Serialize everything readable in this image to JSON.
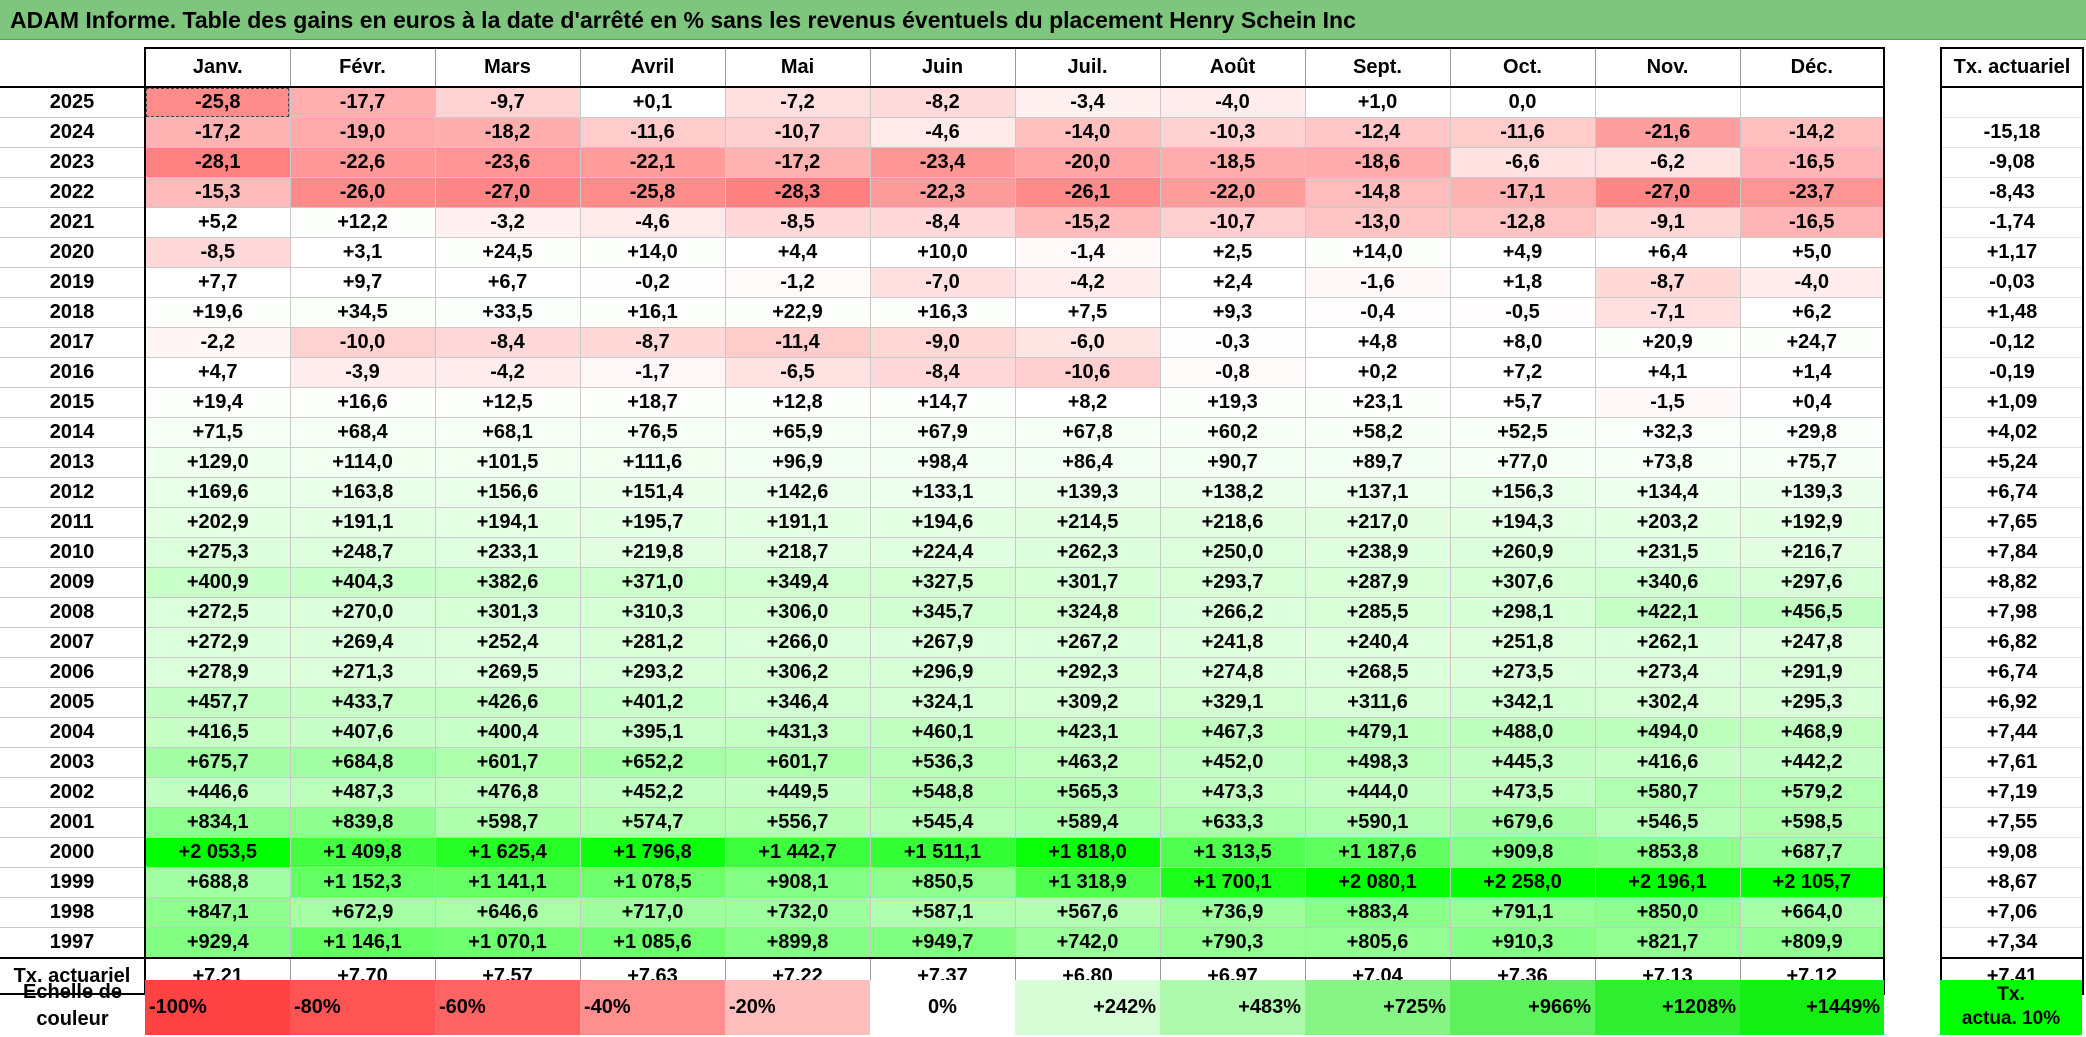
{
  "title": "ADAM Informe. Table des gains en euros à la date d'arrêté en % sans les revenus éventuels du placement Henry Schein Inc",
  "months": [
    "Janv.",
    "Févr.",
    "Mars",
    "Avril",
    "Mai",
    "Juin",
    "Juil.",
    "Août",
    "Sept.",
    "Oct.",
    "Nov.",
    "Déc."
  ],
  "rate_header": "Tx. actuariel",
  "rows": [
    {
      "year": "2025",
      "values": [
        "-25,8",
        "-17,7",
        "-9,7",
        "+0,1",
        "-7,2",
        "-8,2",
        "-3,4",
        "-4,0",
        "+1,0",
        "0,0",
        "",
        ""
      ],
      "rate": ""
    },
    {
      "year": "2024",
      "values": [
        "-17,2",
        "-19,0",
        "-18,2",
        "-11,6",
        "-10,7",
        "-4,6",
        "-14,0",
        "-10,3",
        "-12,4",
        "-11,6",
        "-21,6",
        "-14,2"
      ],
      "rate": "-15,18"
    },
    {
      "year": "2023",
      "values": [
        "-28,1",
        "-22,6",
        "-23,6",
        "-22,1",
        "-17,2",
        "-23,4",
        "-20,0",
        "-18,5",
        "-18,6",
        "-6,6",
        "-6,2",
        "-16,5"
      ],
      "rate": "-9,08"
    },
    {
      "year": "2022",
      "values": [
        "-15,3",
        "-26,0",
        "-27,0",
        "-25,8",
        "-28,3",
        "-22,3",
        "-26,1",
        "-22,0",
        "-14,8",
        "-17,1",
        "-27,0",
        "-23,7"
      ],
      "rate": "-8,43"
    },
    {
      "year": "2021",
      "values": [
        "+5,2",
        "+12,2",
        "-3,2",
        "-4,6",
        "-8,5",
        "-8,4",
        "-15,2",
        "-10,7",
        "-13,0",
        "-12,8",
        "-9,1",
        "-16,5"
      ],
      "rate": "-1,74"
    },
    {
      "year": "2020",
      "values": [
        "-8,5",
        "+3,1",
        "+24,5",
        "+14,0",
        "+4,4",
        "+10,0",
        "-1,4",
        "+2,5",
        "+14,0",
        "+4,9",
        "+6,4",
        "+5,0"
      ],
      "rate": "+1,17"
    },
    {
      "year": "2019",
      "values": [
        "+7,7",
        "+9,7",
        "+6,7",
        "-0,2",
        "-1,2",
        "-7,0",
        "-4,2",
        "+2,4",
        "-1,6",
        "+1,8",
        "-8,7",
        "-4,0"
      ],
      "rate": "-0,03"
    },
    {
      "year": "2018",
      "values": [
        "+19,6",
        "+34,5",
        "+33,5",
        "+16,1",
        "+22,9",
        "+16,3",
        "+7,5",
        "+9,3",
        "-0,4",
        "-0,5",
        "-7,1",
        "+6,2"
      ],
      "rate": "+1,48"
    },
    {
      "year": "2017",
      "values": [
        "-2,2",
        "-10,0",
        "-8,4",
        "-8,7",
        "-11,4",
        "-9,0",
        "-6,0",
        "-0,3",
        "+4,8",
        "+8,0",
        "+20,9",
        "+24,7"
      ],
      "rate": "-0,12"
    },
    {
      "year": "2016",
      "values": [
        "+4,7",
        "-3,9",
        "-4,2",
        "-1,7",
        "-6,5",
        "-8,4",
        "-10,6",
        "-0,8",
        "+0,2",
        "+7,2",
        "+4,1",
        "+1,4"
      ],
      "rate": "-0,19"
    },
    {
      "year": "2015",
      "values": [
        "+19,4",
        "+16,6",
        "+12,5",
        "+18,7",
        "+12,8",
        "+14,7",
        "+8,2",
        "+19,3",
        "+23,1",
        "+5,7",
        "-1,5",
        "+0,4"
      ],
      "rate": "+1,09"
    },
    {
      "year": "2014",
      "values": [
        "+71,5",
        "+68,4",
        "+68,1",
        "+76,5",
        "+65,9",
        "+67,9",
        "+67,8",
        "+60,2",
        "+58,2",
        "+52,5",
        "+32,3",
        "+29,8"
      ],
      "rate": "+4,02"
    },
    {
      "year": "2013",
      "values": [
        "+129,0",
        "+114,0",
        "+101,5",
        "+111,6",
        "+96,9",
        "+98,4",
        "+86,4",
        "+90,7",
        "+89,7",
        "+77,0",
        "+73,8",
        "+75,7"
      ],
      "rate": "+5,24"
    },
    {
      "year": "2012",
      "values": [
        "+169,6",
        "+163,8",
        "+156,6",
        "+151,4",
        "+142,6",
        "+133,1",
        "+139,3",
        "+138,2",
        "+137,1",
        "+156,3",
        "+134,4",
        "+139,3"
      ],
      "rate": "+6,74"
    },
    {
      "year": "2011",
      "values": [
        "+202,9",
        "+191,1",
        "+194,1",
        "+195,7",
        "+191,1",
        "+194,6",
        "+214,5",
        "+218,6",
        "+217,0",
        "+194,3",
        "+203,2",
        "+192,9"
      ],
      "rate": "+7,65"
    },
    {
      "year": "2010",
      "values": [
        "+275,3",
        "+248,7",
        "+233,1",
        "+219,8",
        "+218,7",
        "+224,4",
        "+262,3",
        "+250,0",
        "+238,9",
        "+260,9",
        "+231,5",
        "+216,7"
      ],
      "rate": "+7,84"
    },
    {
      "year": "2009",
      "values": [
        "+400,9",
        "+404,3",
        "+382,6",
        "+371,0",
        "+349,4",
        "+327,5",
        "+301,7",
        "+293,7",
        "+287,9",
        "+307,6",
        "+340,6",
        "+297,6"
      ],
      "rate": "+8,82"
    },
    {
      "year": "2008",
      "values": [
        "+272,5",
        "+270,0",
        "+301,3",
        "+310,3",
        "+306,0",
        "+345,7",
        "+324,8",
        "+266,2",
        "+285,5",
        "+298,1",
        "+422,1",
        "+456,5"
      ],
      "rate": "+7,98"
    },
    {
      "year": "2007",
      "values": [
        "+272,9",
        "+269,4",
        "+252,4",
        "+281,2",
        "+266,0",
        "+267,9",
        "+267,2",
        "+241,8",
        "+240,4",
        "+251,8",
        "+262,1",
        "+247,8"
      ],
      "rate": "+6,82"
    },
    {
      "year": "2006",
      "values": [
        "+278,9",
        "+271,3",
        "+269,5",
        "+293,2",
        "+306,2",
        "+296,9",
        "+292,3",
        "+274,8",
        "+268,5",
        "+273,5",
        "+273,4",
        "+291,9"
      ],
      "rate": "+6,74"
    },
    {
      "year": "2005",
      "values": [
        "+457,7",
        "+433,7",
        "+426,6",
        "+401,2",
        "+346,4",
        "+324,1",
        "+309,2",
        "+329,1",
        "+311,6",
        "+342,1",
        "+302,4",
        "+295,3"
      ],
      "rate": "+6,92"
    },
    {
      "year": "2004",
      "values": [
        "+416,5",
        "+407,6",
        "+400,4",
        "+395,1",
        "+431,3",
        "+460,1",
        "+423,1",
        "+467,3",
        "+479,1",
        "+488,0",
        "+494,0",
        "+468,9"
      ],
      "rate": "+7,44"
    },
    {
      "year": "2003",
      "values": [
        "+675,7",
        "+684,8",
        "+601,7",
        "+652,2",
        "+601,7",
        "+536,3",
        "+463,2",
        "+452,0",
        "+498,3",
        "+445,3",
        "+416,6",
        "+442,2"
      ],
      "rate": "+7,61"
    },
    {
      "year": "2002",
      "values": [
        "+446,6",
        "+487,3",
        "+476,8",
        "+452,2",
        "+449,5",
        "+548,8",
        "+565,3",
        "+473,3",
        "+444,0",
        "+473,5",
        "+580,7",
        "+579,2"
      ],
      "rate": "+7,19"
    },
    {
      "year": "2001",
      "values": [
        "+834,1",
        "+839,8",
        "+598,7",
        "+574,7",
        "+556,7",
        "+545,4",
        "+589,4",
        "+633,3",
        "+590,1",
        "+679,6",
        "+546,5",
        "+598,5"
      ],
      "rate": "+7,55"
    },
    {
      "year": "2000",
      "values": [
        "+2 053,5",
        "+1 409,8",
        "+1 625,4",
        "+1 796,8",
        "+1 442,7",
        "+1 511,1",
        "+1 818,0",
        "+1 313,5",
        "+1 187,6",
        "+909,8",
        "+853,8",
        "+687,7"
      ],
      "rate": "+9,08"
    },
    {
      "year": "1999",
      "values": [
        "+688,8",
        "+1 152,3",
        "+1 141,1",
        "+1 078,5",
        "+908,1",
        "+850,5",
        "+1 318,9",
        "+1 700,1",
        "+2 080,1",
        "+2 258,0",
        "+2 196,1",
        "+2 105,7"
      ],
      "rate": "+8,67"
    },
    {
      "year": "1998",
      "values": [
        "+847,1",
        "+672,9",
        "+646,6",
        "+717,0",
        "+732,0",
        "+587,1",
        "+567,6",
        "+736,9",
        "+883,4",
        "+791,1",
        "+850,0",
        "+664,0"
      ],
      "rate": "+7,06"
    },
    {
      "year": "1997",
      "values": [
        "+929,4",
        "+1 146,1",
        "+1 070,1",
        "+1 085,6",
        "+899,8",
        "+949,7",
        "+742,0",
        "+790,3",
        "+805,6",
        "+910,3",
        "+821,7",
        "+809,9"
      ],
      "rate": "+7,34"
    }
  ],
  "footer": {
    "label": "Tx. actuariel",
    "values": [
      "+7,21",
      "+7,70",
      "+7,57",
      "+7,63",
      "+7,22",
      "+7,37",
      "+6,80",
      "+6,97",
      "+7,04",
      "+7,36",
      "+7,13",
      "+7,12"
    ],
    "rate": "+7,41"
  },
  "legend": {
    "label_line1": "Echelle de",
    "label_line2": "couleur",
    "steps": [
      {
        "label": "-100%",
        "color": "#ff4343"
      },
      {
        "label": "-80%",
        "color": "#ff5454"
      },
      {
        "label": "-60%",
        "color": "#ff6464"
      },
      {
        "label": "-40%",
        "color": "#ff8e8e"
      },
      {
        "label": "-20%",
        "color": "#ffbebe"
      },
      {
        "label": "0%",
        "color": "#ffffff"
      },
      {
        "label": "+242%",
        "color": "#d6fdd6"
      },
      {
        "label": "+483%",
        "color": "#adf9ad"
      },
      {
        "label": "+725%",
        "color": "#86f586"
      },
      {
        "label": "+966%",
        "color": "#5ef15e"
      },
      {
        "label": "+1208%",
        "color": "#2fee2f"
      },
      {
        "label": "+1449%",
        "color": "#13ef13"
      }
    ],
    "rate_line1": "Tx.",
    "rate_line2": "actua. 10%",
    "rate_color": "#00ff00"
  },
  "colors": {
    "title_bar": "#7ec67d",
    "negative_max": "#ff7878",
    "positive_max": "#00ff00"
  }
}
